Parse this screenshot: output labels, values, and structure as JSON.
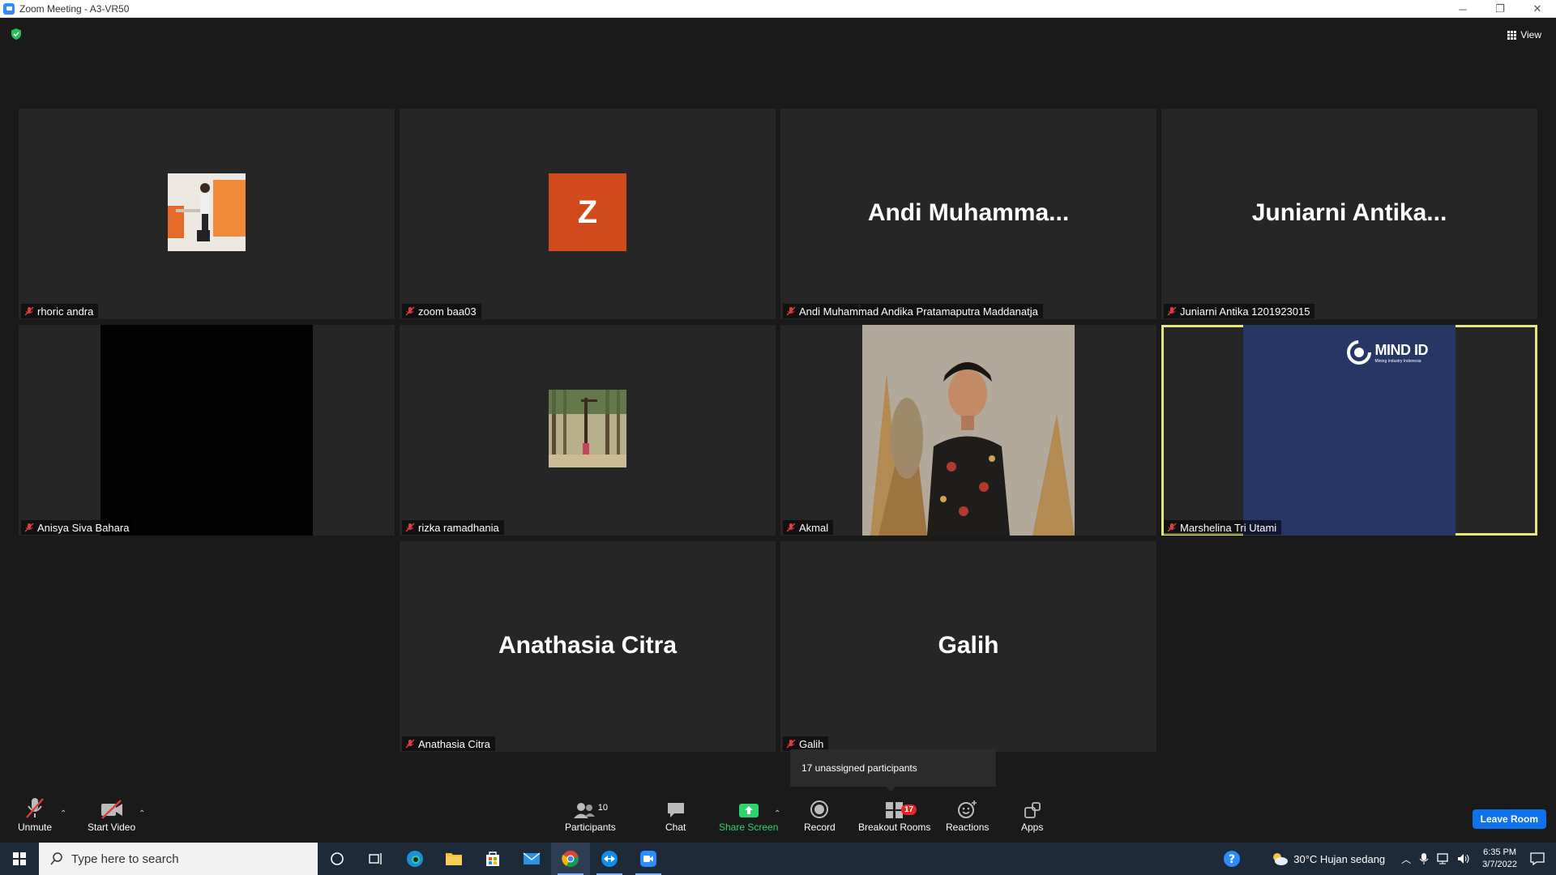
{
  "window": {
    "title": "Zoom Meeting - A3-VR50",
    "minimize": "─",
    "restore": "❐",
    "close": "✕"
  },
  "header": {
    "view_label": "View"
  },
  "tiles": [
    {
      "name": "rhoric andra",
      "display": "photo"
    },
    {
      "name": "zoom baa03",
      "initial": "Z"
    },
    {
      "name": "Andi Muhammad Andika Pratamaputra Maddanatja",
      "big_name": "Andi  Muhamma..."
    },
    {
      "name": "Juniarni Antika 1201923015",
      "big_name": "Juniarni  Antika..."
    },
    {
      "name": "Anisya Siva Bahara",
      "display": "video-black"
    },
    {
      "name": "rizka ramadhania",
      "display": "photo"
    },
    {
      "name": "Akmal",
      "display": "video"
    },
    {
      "name": "Marshelina Tri Utami",
      "display": "video-slide",
      "slide_logo": "MIND ID",
      "slide_sub": "Mining Industry Indonesia",
      "active_speaker": true
    },
    {
      "name": "Anathasia Citra",
      "big_name": "Anathasia Citra"
    },
    {
      "name": "Galih",
      "big_name": "Galih"
    }
  ],
  "tooltip": {
    "text": "17 unassigned participants"
  },
  "toolbar": {
    "unmute": "Unmute",
    "start_video": "Start Video",
    "participants": "Participants",
    "participants_count": "10",
    "chat": "Chat",
    "share_screen": "Share Screen",
    "record": "Record",
    "breakout_rooms": "Breakout Rooms",
    "breakout_badge": "17",
    "reactions": "Reactions",
    "apps": "Apps",
    "leave_room": "Leave Room"
  },
  "taskbar": {
    "search_placeholder": "Type here to search",
    "weather": "30°C  Hujan sedang",
    "time": "6:35 PM",
    "date": "3/7/2022"
  },
  "colors": {
    "active_speaker": "#e8e87a",
    "share_green": "#2cd46b",
    "leave_blue": "#0e72ed",
    "avatar_orange": "#d14a1c",
    "badge_red": "#e02828",
    "slide_navy": "#263766"
  }
}
